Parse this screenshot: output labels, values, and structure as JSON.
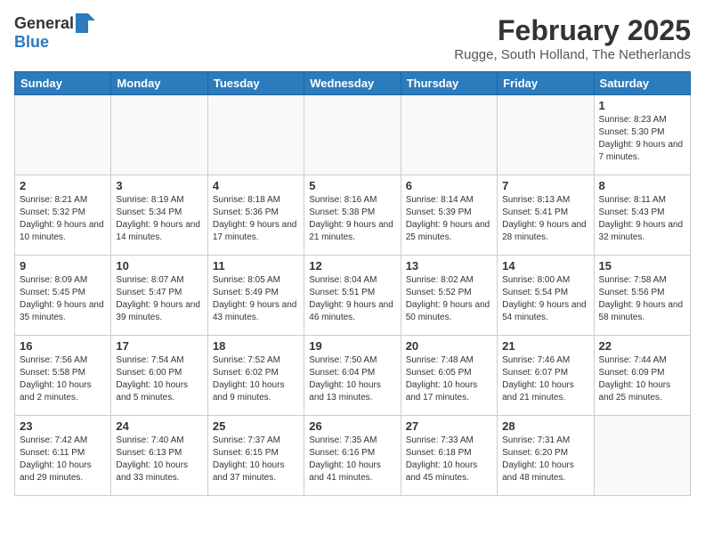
{
  "logo": {
    "general": "General",
    "blue": "Blue"
  },
  "title": "February 2025",
  "subtitle": "Rugge, South Holland, The Netherlands",
  "headers": [
    "Sunday",
    "Monday",
    "Tuesday",
    "Wednesday",
    "Thursday",
    "Friday",
    "Saturday"
  ],
  "weeks": [
    [
      {
        "day": "",
        "sunrise": "",
        "sunset": "",
        "daylight": ""
      },
      {
        "day": "",
        "sunrise": "",
        "sunset": "",
        "daylight": ""
      },
      {
        "day": "",
        "sunrise": "",
        "sunset": "",
        "daylight": ""
      },
      {
        "day": "",
        "sunrise": "",
        "sunset": "",
        "daylight": ""
      },
      {
        "day": "",
        "sunrise": "",
        "sunset": "",
        "daylight": ""
      },
      {
        "day": "",
        "sunrise": "",
        "sunset": "",
        "daylight": ""
      },
      {
        "day": "1",
        "sunrise": "Sunrise: 8:23 AM",
        "sunset": "Sunset: 5:30 PM",
        "daylight": "Daylight: 9 hours and 7 minutes."
      }
    ],
    [
      {
        "day": "2",
        "sunrise": "Sunrise: 8:21 AM",
        "sunset": "Sunset: 5:32 PM",
        "daylight": "Daylight: 9 hours and 10 minutes."
      },
      {
        "day": "3",
        "sunrise": "Sunrise: 8:19 AM",
        "sunset": "Sunset: 5:34 PM",
        "daylight": "Daylight: 9 hours and 14 minutes."
      },
      {
        "day": "4",
        "sunrise": "Sunrise: 8:18 AM",
        "sunset": "Sunset: 5:36 PM",
        "daylight": "Daylight: 9 hours and 17 minutes."
      },
      {
        "day": "5",
        "sunrise": "Sunrise: 8:16 AM",
        "sunset": "Sunset: 5:38 PM",
        "daylight": "Daylight: 9 hours and 21 minutes."
      },
      {
        "day": "6",
        "sunrise": "Sunrise: 8:14 AM",
        "sunset": "Sunset: 5:39 PM",
        "daylight": "Daylight: 9 hours and 25 minutes."
      },
      {
        "day": "7",
        "sunrise": "Sunrise: 8:13 AM",
        "sunset": "Sunset: 5:41 PM",
        "daylight": "Daylight: 9 hours and 28 minutes."
      },
      {
        "day": "8",
        "sunrise": "Sunrise: 8:11 AM",
        "sunset": "Sunset: 5:43 PM",
        "daylight": "Daylight: 9 hours and 32 minutes."
      }
    ],
    [
      {
        "day": "9",
        "sunrise": "Sunrise: 8:09 AM",
        "sunset": "Sunset: 5:45 PM",
        "daylight": "Daylight: 9 hours and 35 minutes."
      },
      {
        "day": "10",
        "sunrise": "Sunrise: 8:07 AM",
        "sunset": "Sunset: 5:47 PM",
        "daylight": "Daylight: 9 hours and 39 minutes."
      },
      {
        "day": "11",
        "sunrise": "Sunrise: 8:05 AM",
        "sunset": "Sunset: 5:49 PM",
        "daylight": "Daylight: 9 hours and 43 minutes."
      },
      {
        "day": "12",
        "sunrise": "Sunrise: 8:04 AM",
        "sunset": "Sunset: 5:51 PM",
        "daylight": "Daylight: 9 hours and 46 minutes."
      },
      {
        "day": "13",
        "sunrise": "Sunrise: 8:02 AM",
        "sunset": "Sunset: 5:52 PM",
        "daylight": "Daylight: 9 hours and 50 minutes."
      },
      {
        "day": "14",
        "sunrise": "Sunrise: 8:00 AM",
        "sunset": "Sunset: 5:54 PM",
        "daylight": "Daylight: 9 hours and 54 minutes."
      },
      {
        "day": "15",
        "sunrise": "Sunrise: 7:58 AM",
        "sunset": "Sunset: 5:56 PM",
        "daylight": "Daylight: 9 hours and 58 minutes."
      }
    ],
    [
      {
        "day": "16",
        "sunrise": "Sunrise: 7:56 AM",
        "sunset": "Sunset: 5:58 PM",
        "daylight": "Daylight: 10 hours and 2 minutes."
      },
      {
        "day": "17",
        "sunrise": "Sunrise: 7:54 AM",
        "sunset": "Sunset: 6:00 PM",
        "daylight": "Daylight: 10 hours and 5 minutes."
      },
      {
        "day": "18",
        "sunrise": "Sunrise: 7:52 AM",
        "sunset": "Sunset: 6:02 PM",
        "daylight": "Daylight: 10 hours and 9 minutes."
      },
      {
        "day": "19",
        "sunrise": "Sunrise: 7:50 AM",
        "sunset": "Sunset: 6:04 PM",
        "daylight": "Daylight: 10 hours and 13 minutes."
      },
      {
        "day": "20",
        "sunrise": "Sunrise: 7:48 AM",
        "sunset": "Sunset: 6:05 PM",
        "daylight": "Daylight: 10 hours and 17 minutes."
      },
      {
        "day": "21",
        "sunrise": "Sunrise: 7:46 AM",
        "sunset": "Sunset: 6:07 PM",
        "daylight": "Daylight: 10 hours and 21 minutes."
      },
      {
        "day": "22",
        "sunrise": "Sunrise: 7:44 AM",
        "sunset": "Sunset: 6:09 PM",
        "daylight": "Daylight: 10 hours and 25 minutes."
      }
    ],
    [
      {
        "day": "23",
        "sunrise": "Sunrise: 7:42 AM",
        "sunset": "Sunset: 6:11 PM",
        "daylight": "Daylight: 10 hours and 29 minutes."
      },
      {
        "day": "24",
        "sunrise": "Sunrise: 7:40 AM",
        "sunset": "Sunset: 6:13 PM",
        "daylight": "Daylight: 10 hours and 33 minutes."
      },
      {
        "day": "25",
        "sunrise": "Sunrise: 7:37 AM",
        "sunset": "Sunset: 6:15 PM",
        "daylight": "Daylight: 10 hours and 37 minutes."
      },
      {
        "day": "26",
        "sunrise": "Sunrise: 7:35 AM",
        "sunset": "Sunset: 6:16 PM",
        "daylight": "Daylight: 10 hours and 41 minutes."
      },
      {
        "day": "27",
        "sunrise": "Sunrise: 7:33 AM",
        "sunset": "Sunset: 6:18 PM",
        "daylight": "Daylight: 10 hours and 45 minutes."
      },
      {
        "day": "28",
        "sunrise": "Sunrise: 7:31 AM",
        "sunset": "Sunset: 6:20 PM",
        "daylight": "Daylight: 10 hours and 48 minutes."
      },
      {
        "day": "",
        "sunrise": "",
        "sunset": "",
        "daylight": ""
      }
    ]
  ]
}
